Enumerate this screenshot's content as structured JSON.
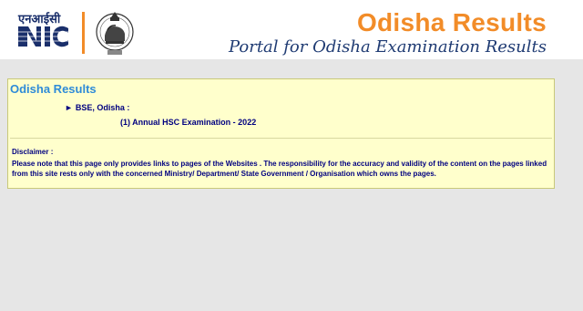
{
  "header": {
    "logo_hindi": "एनआईसी",
    "logo_text": "NIC",
    "title": "Odisha Results",
    "subtitle": "Portal for Odisha Examination Results"
  },
  "panel": {
    "title": "Odisha Results",
    "board": "BSE, Odisha :",
    "exam_link": "(1) Annual HSC Examination - 2022",
    "disclaimer_title": "Disclaimer :",
    "disclaimer_text": "Please note that this page only provides links to pages of the Websites . The responsibility for the accuracy and validity of the content on the pages linked from this site rests only with the concerned Ministry/ Department/ State Government / Organisation which owns the pages."
  },
  "colors": {
    "accent": "#f28c28",
    "navy": "#000080",
    "panel_bg": "#ffffcc",
    "link_blue": "#2e8bd8"
  }
}
